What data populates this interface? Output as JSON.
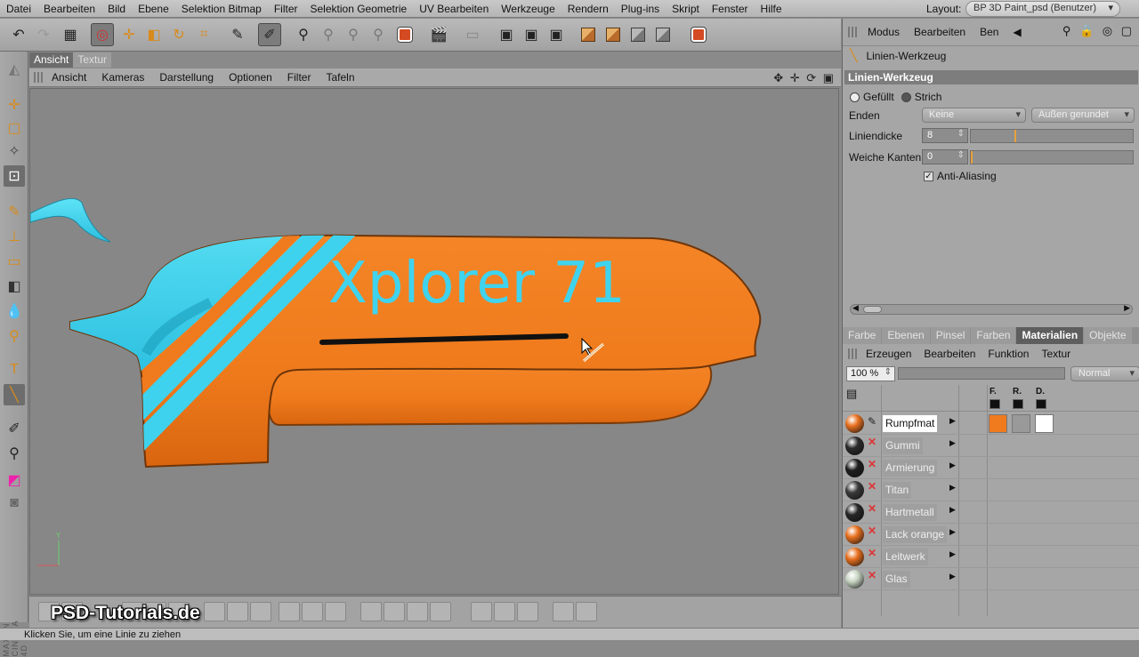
{
  "menubar": {
    "items": [
      "Datei",
      "Bearbeiten",
      "Bild",
      "Ebene",
      "Selektion Bitmap",
      "Filter",
      "Selektion Geometrie",
      "UV Bearbeiten",
      "Werkzeuge",
      "Rendern",
      "Plug-ins",
      "Skript",
      "Fenster",
      "Hilfe"
    ],
    "layout_label": "Layout:",
    "layout_value": "BP 3D Paint_psd (Benutzer)"
  },
  "viewport": {
    "tabs": [
      "Ansicht",
      "Textur"
    ],
    "menu": [
      "Ansicht",
      "Kameras",
      "Darstellung",
      "Optionen",
      "Filter",
      "Tafeln"
    ],
    "text": "Xplorer 71"
  },
  "attributes": {
    "menu": [
      "Modus",
      "Bearbeiten",
      "Ben"
    ],
    "tool_name": "Linien-Werkzeug",
    "section_title": "Linien-Werkzeug",
    "fill_options": [
      "Gefüllt",
      "Strich"
    ],
    "selected_fill": "Strich",
    "enden_label": "Enden",
    "enden_start": "Keine",
    "enden_end": "Außen gerundet",
    "liniendicke_label": "Liniendicke",
    "liniendicke_value": "8",
    "liniendicke_fraction": 0.27,
    "weiche_kanten_label": "Weiche Kanten",
    "weiche_kanten_value": "0",
    "weiche_kanten_fraction": 0.0,
    "anti_aliasing_label": "Anti-Aliasing",
    "anti_aliasing_checked": true
  },
  "lower_panel": {
    "tabs": [
      "Farbe",
      "Ebenen",
      "Pinsel",
      "Farben",
      "Materialien",
      "Objekte"
    ],
    "active_tab": "Materialien",
    "menu": [
      "Erzeugen",
      "Bearbeiten",
      "Funktion",
      "Textur"
    ],
    "opacity": "100 %",
    "blend_mode": "Normal",
    "channel_headers": [
      "F.",
      "R.",
      "D."
    ],
    "materials": [
      {
        "name": "Rumpfmat",
        "selected": true,
        "ball_color": "#e8701e",
        "editing": true
      },
      {
        "name": "Gummi",
        "selected": false,
        "ball_color": "#2b2b2b",
        "editing": false
      },
      {
        "name": "Armierung",
        "selected": false,
        "ball_color": "#1e1e1e",
        "editing": false
      },
      {
        "name": "Titan",
        "selected": false,
        "ball_color": "#3a3a3a",
        "editing": false
      },
      {
        "name": "Hartmetall",
        "selected": false,
        "ball_color": "#262626",
        "editing": false
      },
      {
        "name": "Lack orange",
        "selected": false,
        "ball_color": "#e8701e",
        "editing": false
      },
      {
        "name": "Leitwerk",
        "selected": false,
        "ball_color": "#e8701e",
        "editing": false
      },
      {
        "name": "Glas",
        "selected": false,
        "ball_color": "#c9d6c3",
        "editing": false
      }
    ]
  },
  "watermark": "PSD-Tutorials.de",
  "vertical_logo": "MAXON CINEMA 4D",
  "status": "Klicken Sie, um eine Linie zu ziehen",
  "colors": {
    "orange": "#f07a1e",
    "cyan": "#3ed2ee",
    "accent": "#e8a23a"
  }
}
